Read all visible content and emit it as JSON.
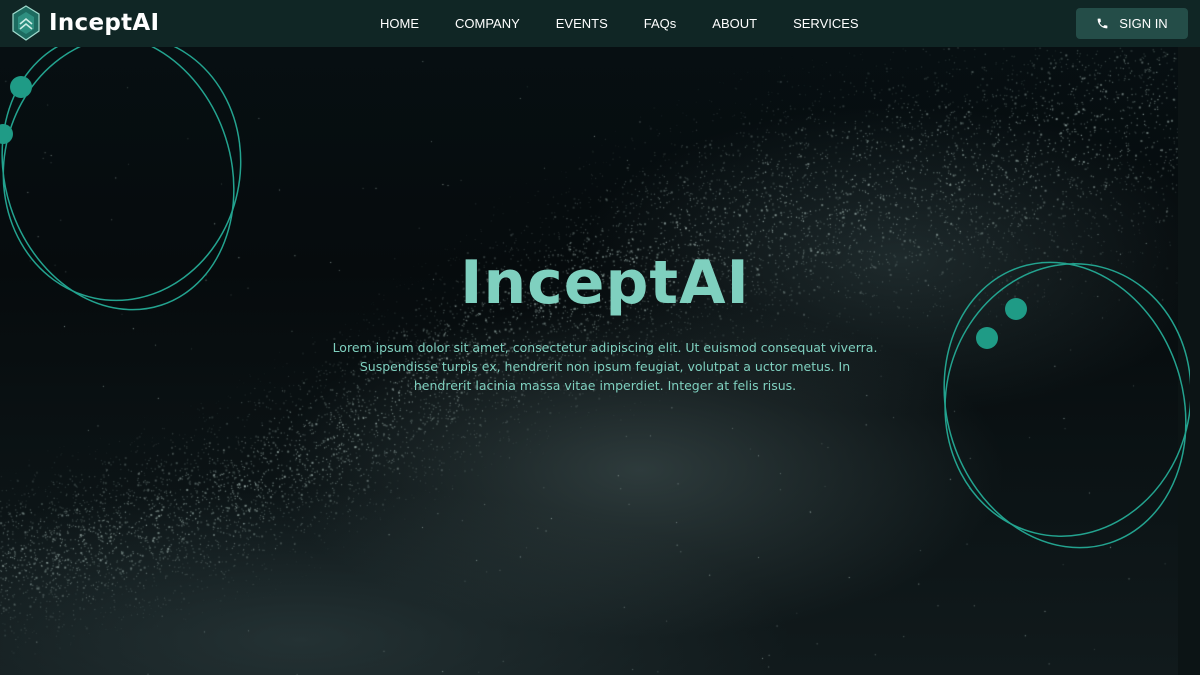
{
  "navbar": {
    "brand_name": "InceptAI",
    "links": [
      "HOME",
      "COMPANY",
      "EVENTS",
      "FAQs",
      "ABOUT",
      "SERVICES"
    ],
    "signin_label": "SIGN IN"
  },
  "hero": {
    "title": "InceptAI",
    "text": "Lorem ipsum dolor sit amet, consectetur adipiscing elit. Ut euismod consequat viverra. Suspendisse turpis ex, hendrerit non ipsum feugiat, volutpat a uctor metus. In hendrerit lacinia massa vitae imperdiet. Integer at felis risus."
  },
  "icons": {
    "brand": "shield-logo-icon",
    "signin": "phone-icon"
  },
  "colors": {
    "navbar_bg": "#102625",
    "accent": "#7fd0bf",
    "orbit": "#23a38f",
    "signin_bg": "#244d48"
  }
}
